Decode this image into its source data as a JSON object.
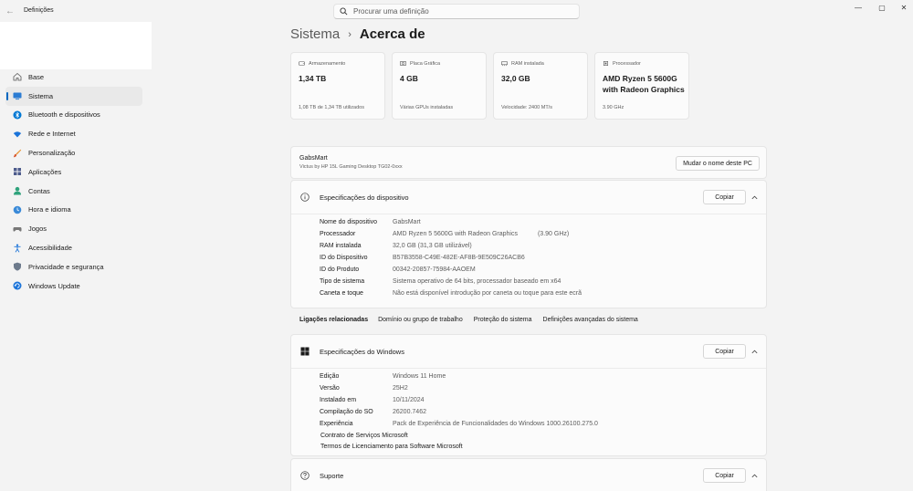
{
  "window": {
    "title": "Definições",
    "search_placeholder": "Procurar uma definição",
    "minimize": "—",
    "maximize": "▢",
    "close": "✕"
  },
  "sidebar": {
    "items": [
      {
        "label": "Base",
        "icon": "home-icon"
      },
      {
        "label": "Sistema",
        "icon": "system-icon",
        "active": true
      },
      {
        "label": "Bluetooth e dispositivos",
        "icon": "bluetooth-icon"
      },
      {
        "label": "Rede e Internet",
        "icon": "wifi-icon"
      },
      {
        "label": "Personalização",
        "icon": "brush-icon"
      },
      {
        "label": "Aplicações",
        "icon": "apps-icon"
      },
      {
        "label": "Contas",
        "icon": "account-icon"
      },
      {
        "label": "Hora e idioma",
        "icon": "globe-icon"
      },
      {
        "label": "Jogos",
        "icon": "gamepad-icon"
      },
      {
        "label": "Acessibilidade",
        "icon": "accessibility-icon"
      },
      {
        "label": "Privacidade e segurança",
        "icon": "shield-icon"
      },
      {
        "label": "Windows Update",
        "icon": "update-icon"
      }
    ]
  },
  "header": {
    "parent": "Sistema",
    "separator": "›",
    "current": "Acerca de"
  },
  "tiles": [
    {
      "label": "Armazenamento",
      "value": "1,34 TB",
      "foot": "1,08 TB de 1,34 TB utilizados",
      "icon": "storage-icon"
    },
    {
      "label": "Placa Gráfica",
      "value": "4 GB",
      "foot": "Várias GPUs instaladas",
      "icon": "gpu-icon"
    },
    {
      "label": "RAM instalada",
      "value": "32,0 GB",
      "foot": "Velocidade: 2400 MT/s",
      "icon": "ram-icon"
    },
    {
      "label": "Processador",
      "value": "AMD Ryzen 5 5600G with Radeon Graphics",
      "foot": "3.90 GHz",
      "icon": "cpu-icon"
    }
  ],
  "device": {
    "name": "GabsMart",
    "model": "Victus by HP 15L Gaming Desktop TG02-0xxx",
    "rename_label": "Mudar o nome deste PC"
  },
  "device_specs": {
    "title": "Especificações do dispositivo",
    "copy_label": "Copiar",
    "rows": [
      {
        "label": "Nome do dispositivo",
        "value": "GabsMart",
        "extra": ""
      },
      {
        "label": "Processador",
        "value": "AMD Ryzen 5 5600G with Radeon Graphics",
        "extra": "(3.90 GHz)"
      },
      {
        "label": "RAM instalada",
        "value": "32,0 GB (31,3 GB utilizável)",
        "extra": ""
      },
      {
        "label": "ID do Dispositivo",
        "value": "B57B3558-C49E-482E-AF8B-9E509C26ACB6",
        "extra": ""
      },
      {
        "label": "ID do Produto",
        "value": "00342-20857-75984-AAOEM",
        "extra": ""
      },
      {
        "label": "Tipo de sistema",
        "value": "Sistema operativo de 64 bits, processador baseado em x64",
        "extra": ""
      },
      {
        "label": "Caneta e toque",
        "value": "Não está disponível introdução por caneta ou toque para este ecrã",
        "extra": ""
      }
    ]
  },
  "related": {
    "title": "Ligações relacionadas",
    "links": [
      "Domínio ou grupo de trabalho",
      "Proteção do sistema",
      "Definições avançadas do sistema"
    ]
  },
  "windows_specs": {
    "title": "Especificações do Windows",
    "copy_label": "Copiar",
    "rows": [
      {
        "label": "Edição",
        "value": "Windows 11 Home"
      },
      {
        "label": "Versão",
        "value": "25H2"
      },
      {
        "label": "Instalado em",
        "value": "10/11/2024"
      },
      {
        "label": "Compilação do SO",
        "value": "26200.7462"
      },
      {
        "label": "Experiência",
        "value": "Pack de Experiência de Funcionalidades do Windows 1000.26100.275.0"
      }
    ],
    "links": [
      "Contrato de Serviços Microsoft",
      "Termos de Licenciamento para Software Microsoft"
    ]
  },
  "support": {
    "title": "Suporte",
    "copy_label": "Copiar"
  },
  "colors": {
    "accent": "#0067c0",
    "background": "#f3f3f3",
    "card": "#fbfbfb"
  }
}
